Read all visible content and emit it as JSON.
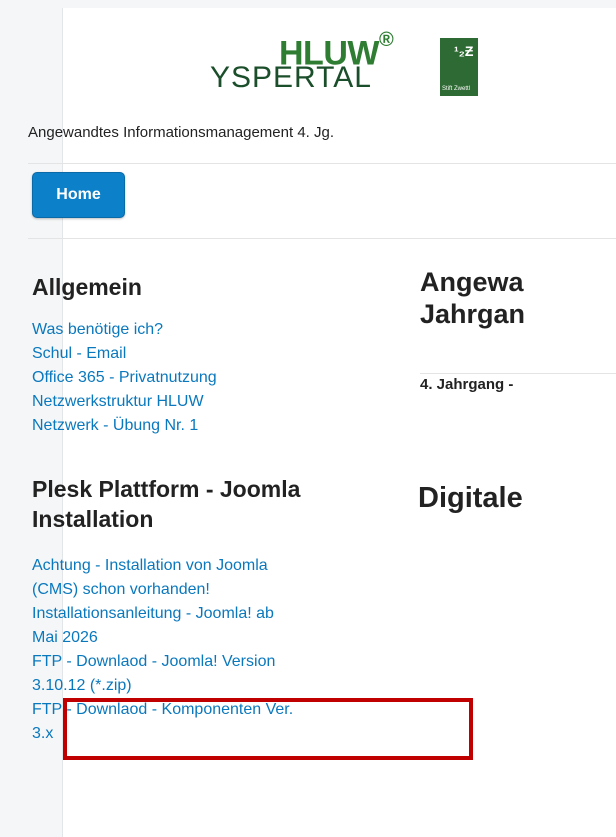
{
  "header": {
    "logo_top": "HLUW",
    "logo_reg": "®",
    "logo_bottom": "YSPERTAL",
    "logo_box_mark": "¹₂Ƶ",
    "logo_box_text": "Stift Zwettl",
    "subtitle": "Angewandtes Informationsmanagement 4. Jg."
  },
  "nav": {
    "home_label": "Home"
  },
  "sidebar": {
    "sections": [
      {
        "heading": "Allgemein",
        "items": [
          "Was benötige ich?",
          "Schul - Email",
          "Office 365 - Privatnutzung",
          "Netzwerkstruktur HLUW",
          "Netzwerk - Übung Nr. 1"
        ]
      },
      {
        "heading_line1": "Plesk Plattform - Joomla",
        "heading_line2": "Installation",
        "items": [
          "Achtung - Installation von Joomla",
          "(CMS) schon vorhanden!",
          "Installationsanleitung - Joomla! ab",
          "Mai 2026",
          "FTP - Downlaod - Joomla! Version",
          "3.10.12 (*.zip)",
          "FTP - Downlaod - Komponenten Ver.",
          "3.x"
        ]
      }
    ]
  },
  "main": {
    "heading_line1": "Angewa",
    "heading_line2": "Jahrgan",
    "subheading": "4. Jahrgang -",
    "heading2": "Digitale"
  },
  "colors": {
    "link": "#0a78bd",
    "home_button": "#0c80c8",
    "highlight": "#c00000",
    "logo_green": "#2e7d32"
  }
}
